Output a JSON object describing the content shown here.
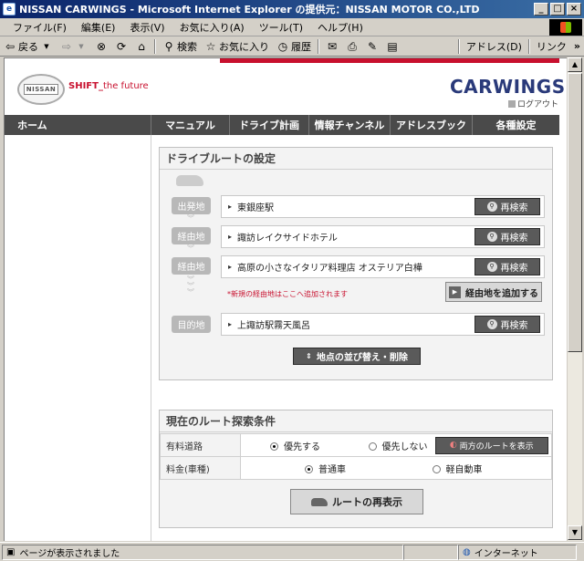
{
  "window": {
    "title": "NISSAN CARWINGS - Microsoft Internet Explorer の提供元：NISSAN MOTOR CO.,LTD"
  },
  "menu": [
    "ファイル(F)",
    "編集(E)",
    "表示(V)",
    "お気に入り(A)",
    "ツール(T)",
    "ヘルプ(H)"
  ],
  "toolbar": {
    "back": "戻る",
    "search": "検索",
    "favorites": "お気に入り",
    "history": "履歴",
    "address": "アドレス(D)",
    "links": "リンク"
  },
  "header": {
    "nissan": "NISSAN",
    "shift_bold": "SHIFT_",
    "shift_thin": "the future",
    "carwings": "CARWINGS",
    "logout": "ログアウト"
  },
  "nav": [
    "ホーム",
    "マニュアル",
    "ドライブ計画",
    "情報チャンネル",
    "アドレスブック",
    "各種設定"
  ],
  "route": {
    "title": "ドライブルートの設定",
    "labels": {
      "start": "出発地",
      "via": "経由地",
      "dest": "目的地"
    },
    "points": [
      "東銀座駅",
      "諏訪レイクサイドホテル",
      "高原の小さなイタリア料理店 オステリア白樺",
      "上諏訪駅霧天風呂"
    ],
    "research": "再検索",
    "notice": "*新規の経由地はここへ追加されます",
    "add_via": "経由地を追加する",
    "reorder": "地点の並び替え・削除"
  },
  "conditions": {
    "title": "現在のルート探索条件",
    "toll_label": "有料道路",
    "toll_prefer": "優先する",
    "toll_no": "優先しない",
    "both": "両方のルートを表示",
    "fee_label": "料金(車種)",
    "fee_normal": "普通車",
    "fee_kei": "軽自動車",
    "redisplay": "ルートの再表示"
  },
  "status": {
    "text": "ページが表示されました",
    "zone": "インターネット"
  }
}
